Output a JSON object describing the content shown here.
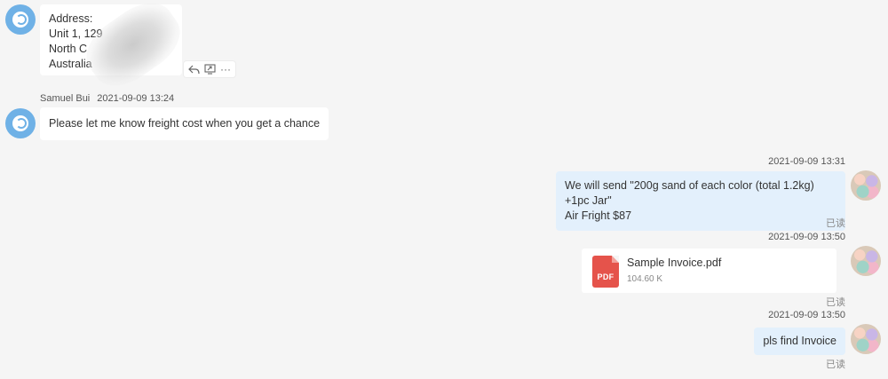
{
  "messages": {
    "address": {
      "lines": [
        "Address:",
        "Unit 1, 129",
        "North C",
        "Australia"
      ]
    },
    "actions": {
      "reply": "reply-icon",
      "forward": "forward-icon",
      "more_label": "···"
    },
    "msg2": {
      "sender": "Samuel Bui",
      "time": "2021-09-09 13:24",
      "text": "Please let me know freight cost when you get a chance"
    },
    "msg3": {
      "time": "2021-09-09 13:31",
      "line1": "We will send \"200g sand of each color (total 1.2kg) +1pc Jar\"",
      "line2": "Air Fright $87",
      "status": "已读"
    },
    "file": {
      "time": "2021-09-09 13:50",
      "icon_label": "PDF",
      "name": "Sample Invoice.pdf",
      "size": "104.60 K",
      "status": "已读"
    },
    "msg4": {
      "time": "2021-09-09 13:50",
      "text": "pls find Invoice",
      "status": "已读"
    }
  },
  "colors": {
    "background": "#f5f5f5",
    "incoming_bubble": "#ffffff",
    "outgoing_bubble": "#e3f0fc",
    "avatar_blue": "#6fb1e6",
    "pdf_red": "#e5534b"
  }
}
